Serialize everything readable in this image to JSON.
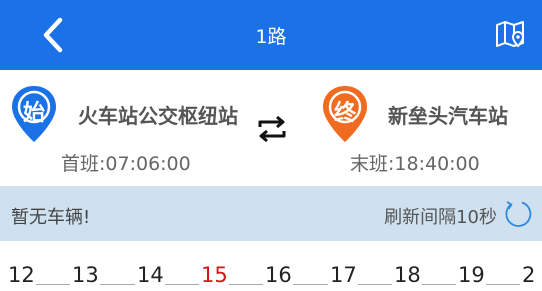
{
  "colors": {
    "header_bg": "#1a72e6",
    "start_pin": "#1a72e6",
    "end_pin": "#f06a1f",
    "status_bar_bg": "#cfe0ef",
    "current_station": "#d41515"
  },
  "header": {
    "title": "1路",
    "back_icon": "chevron-left-icon",
    "map_icon": "map-pin-icon"
  },
  "route": {
    "start": {
      "badge": "始",
      "name": "火车站公交枢纽站",
      "time": "首班:07:06:00"
    },
    "end": {
      "badge": "终",
      "name": "新垒头汽车站",
      "time": "末班:18:40:00"
    },
    "swap_icon": "swap-direction-icon"
  },
  "status": {
    "no_vehicle": "暂无车辆!",
    "refresh_text": "刷新间隔10秒",
    "refresh_icon": "refresh-icon"
  },
  "stations": {
    "items": [
      {
        "label": "12"
      },
      {
        "label": "13"
      },
      {
        "label": "14"
      },
      {
        "label": "15",
        "current": true
      },
      {
        "label": "16"
      },
      {
        "label": "17"
      },
      {
        "label": "18"
      },
      {
        "label": "19"
      },
      {
        "label": "2"
      }
    ]
  }
}
